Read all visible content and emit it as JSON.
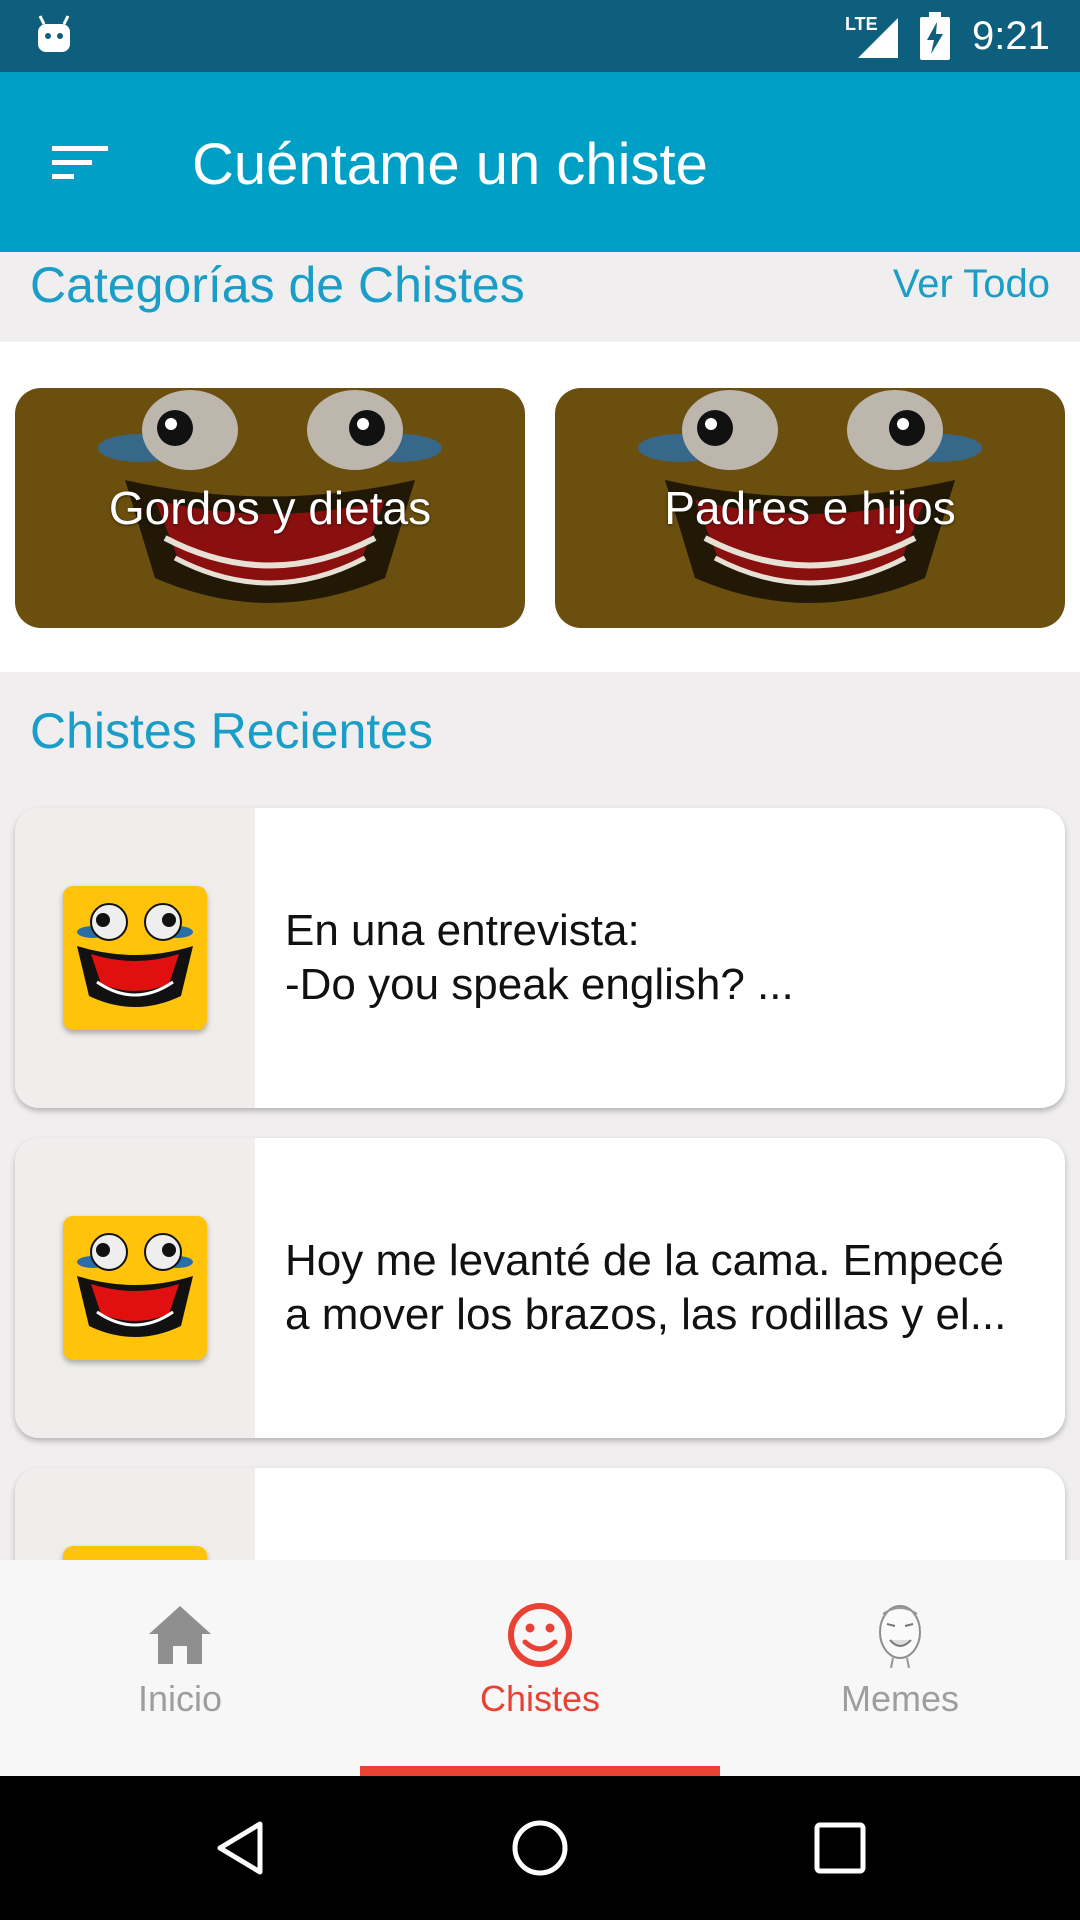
{
  "status_bar": {
    "network": "LTE",
    "time": "9:21"
  },
  "app_bar": {
    "title": "Cuéntame un chiste",
    "menu_icon": "sort-menu-icon"
  },
  "categories_section": {
    "title": "Categorías de Chistes",
    "see_all_label": "Ver Todo",
    "items": [
      {
        "label": "Gordos y dietas"
      },
      {
        "label": "Padres e hijos"
      }
    ]
  },
  "recent_section": {
    "title": "Chistes Recientes",
    "jokes": [
      {
        "text": "En una entrevista:\n-Do you speak english? ..."
      },
      {
        "text": "Hoy me levanté de la cama. Empecé\na mover los brazos, las rodillas y el..."
      },
      {
        "text": ""
      }
    ]
  },
  "bottom_nav": {
    "items": [
      {
        "label": "Inicio",
        "icon": "home-icon",
        "active": false
      },
      {
        "label": "Chistes",
        "icon": "smiley-icon",
        "active": true
      },
      {
        "label": "Memes",
        "icon": "meme-face-icon",
        "active": false
      }
    ]
  },
  "colors": {
    "status_bar": "#0d5f7d",
    "app_bar": "#00a0c6",
    "accent_text": "#1a9ec7",
    "active_nav": "#e94234",
    "inactive_nav": "#9e9e9e"
  }
}
